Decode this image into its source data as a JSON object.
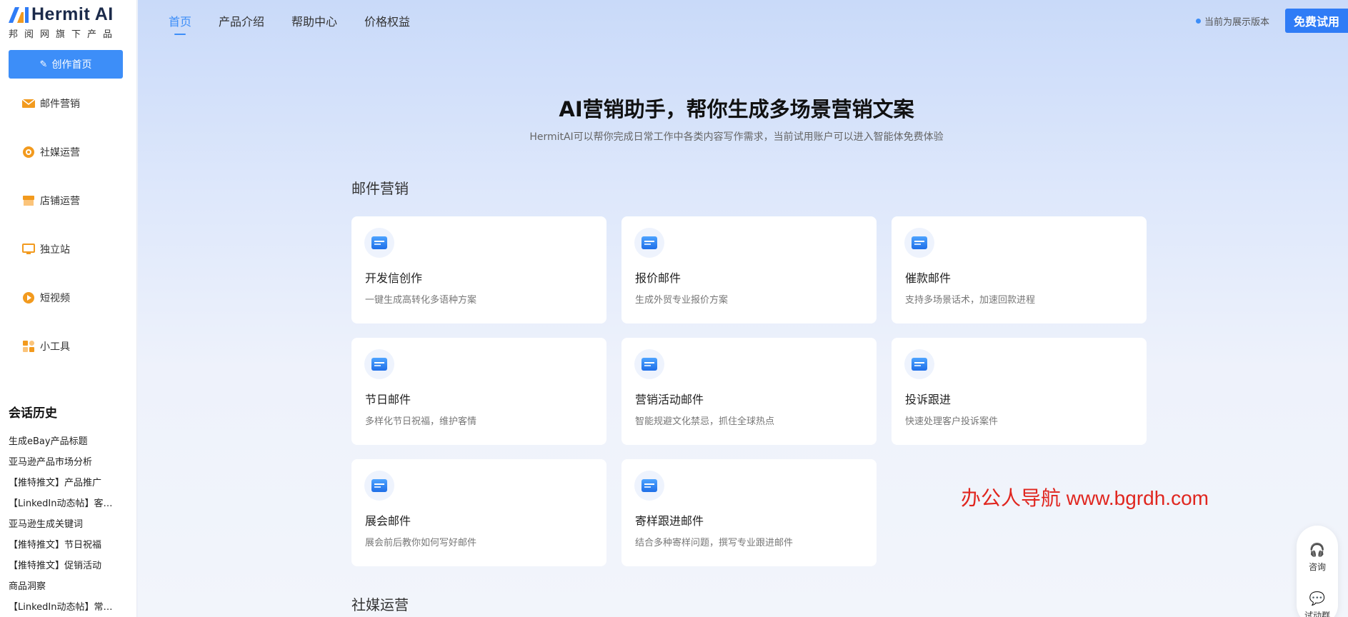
{
  "brand": {
    "name": "Hermit AI",
    "tagline": "邦阅网旗下产品",
    "accent": "#3d8ef8"
  },
  "sidebar": {
    "create_label": "创作首页",
    "items": [
      {
        "label": "邮件营销",
        "icon": "mail-icon"
      },
      {
        "label": "社媒运营",
        "icon": "social-icon"
      },
      {
        "label": "店铺运营",
        "icon": "store-icon"
      },
      {
        "label": "独立站",
        "icon": "monitor-icon"
      },
      {
        "label": "短视频",
        "icon": "play-icon"
      },
      {
        "label": "小工具",
        "icon": "tools-icon"
      }
    ],
    "history_title": "会话历史",
    "history": [
      "生成eBay产品标题",
      "亚马逊产品市场分析",
      "【推特推文】产品推广",
      "【LinkedIn动态帖】客…",
      "亚马逊生成关键词",
      "【推特推文】节日祝福",
      "【推特推文】促销活动",
      "商品洞察",
      "【LinkedIn动态帖】常…"
    ]
  },
  "topnav": {
    "items": [
      "首页",
      "产品介绍",
      "帮助中心",
      "价格权益"
    ],
    "active": "首页",
    "version_text": "当前为展示版本",
    "trial_label": "免费试用"
  },
  "hero": {
    "title": "AI营销助手，帮你生成多场景营销文案",
    "subtitle": "HermitAI可以帮你完成日常工作中各类内容写作需求，当前试用账户可以进入智能体免费体验"
  },
  "sections": [
    {
      "title": "邮件营销",
      "cards": [
        {
          "title": "开发信创作",
          "desc": "一键生成高转化多语种方案"
        },
        {
          "title": "报价邮件",
          "desc": "生成外贸专业报价方案"
        },
        {
          "title": "催款邮件",
          "desc": "支持多场景话术，加速回款进程"
        },
        {
          "title": "节日邮件",
          "desc": "多样化节日祝福，维护客情"
        },
        {
          "title": "营销活动邮件",
          "desc": "智能规避文化禁忌，抓住全球热点"
        },
        {
          "title": "投诉跟进",
          "desc": "快速处理客户投诉案件"
        },
        {
          "title": "展会邮件",
          "desc": "展会前后教你如何写好邮件"
        },
        {
          "title": "寄样跟进邮件",
          "desc": "结合多种寄样问题，撰写专业跟进邮件"
        }
      ]
    },
    {
      "title": "社媒运营",
      "cards": []
    }
  ],
  "watermark": "办公人导航 www.bgrdh.com",
  "float_bar": {
    "consult_label": "咨询",
    "wechat_label": "试动群"
  }
}
